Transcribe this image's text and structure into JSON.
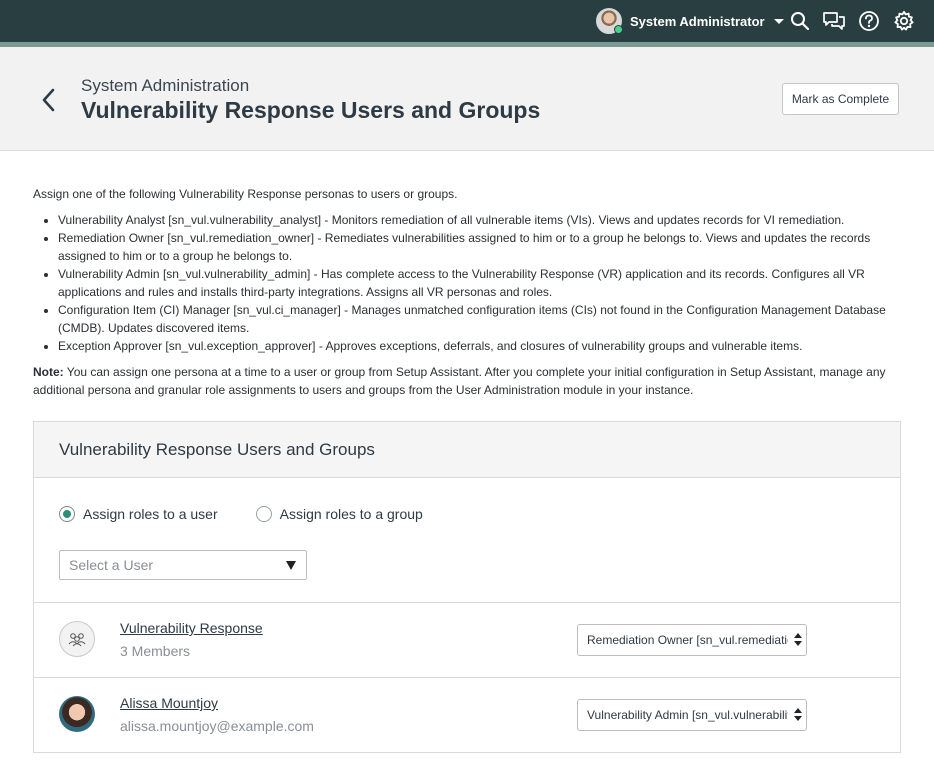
{
  "topbar": {
    "user_name": "System Administrator",
    "icons": [
      "search-icon",
      "chat-icon",
      "help-icon",
      "gear-icon"
    ]
  },
  "header": {
    "breadcrumb": "System Administration",
    "title": "Vulnerability Response Users and Groups",
    "mark_complete_label": "Mark as Complete"
  },
  "content": {
    "intro": "Assign one of the following Vulnerability Response personas to users or groups.",
    "personas": [
      "Vulnerability Analyst [sn_vul.vulnerability_analyst] - Monitors remediation of all vulnerable items (VIs). Views and updates records for VI remediation.",
      "Remediation Owner [sn_vul.remediation_owner] - Remediates vulnerabilities assigned to him or to a group he belongs to. Views and updates the records assigned to him or to a group he belongs to.",
      "Vulnerability Admin [sn_vul.vulnerability_admin] - Has complete access to the Vulnerability Response (VR) application and its records. Configures all VR applications and rules and installs third-party integrations. Assigns all VR personas and roles.",
      "Configuration Item (CI) Manager [sn_vul.ci_manager] - Manages unmatched configuration items (CIs) not found in the Configuration Management Database (CMDB). Updates discovered items.",
      "Exception Approver [sn_vul.exception_approver] - Approves exceptions, deferrals, and closures of vulnerability groups and vulnerable items."
    ],
    "note_label": "Note:",
    "note_text": " You can assign one persona at a time to a user or group from Setup Assistant. After you complete your initial configuration in Setup Assistant, manage any additional persona and granular role assignments to users and groups from the User Administration module in your instance."
  },
  "panel": {
    "title": "Vulnerability Response Users and Groups",
    "radio_user_label": "Assign roles to a user",
    "radio_group_label": "Assign roles to a group",
    "selected_radio": "user",
    "select_user_placeholder": "Select a User",
    "rows": [
      {
        "type": "group",
        "name": "Vulnerability Response",
        "sub": "3 Members",
        "role": "Remediation Owner [sn_vul.remediation_owner]"
      },
      {
        "type": "user",
        "name": "Alissa Mountjoy",
        "sub": "alissa.mountjoy@example.com",
        "role": "Vulnerability Admin [sn_vul.vulnerability_admin]"
      }
    ]
  },
  "colors": {
    "topbar": "#293e40",
    "topbar_accent": "#7a9a93",
    "radio_selected": "#2c8f7a"
  }
}
